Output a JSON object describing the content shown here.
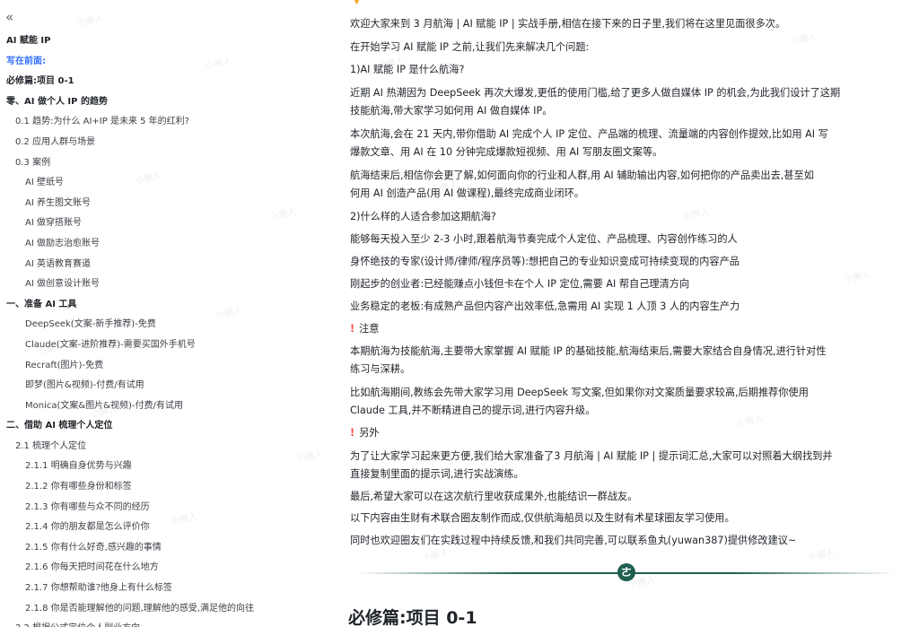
{
  "sidebar": {
    "toc": [
      {
        "label": "AI 赋能 IP",
        "level": 1
      },
      {
        "label": "写在前面:",
        "level": 1,
        "active": true
      },
      {
        "label": "必修篇:项目 0-1",
        "level": 1
      },
      {
        "label": "零、AI 做个人 IP 的趋势",
        "level": 1
      },
      {
        "label": "0.1 趋势:为什么 AI+IP 是未来 5 年的红利?",
        "level": 2
      },
      {
        "label": "0.2 应用人群与场景",
        "level": 2
      },
      {
        "label": "0.3 案例",
        "level": 2
      },
      {
        "label": "AI 壁纸号",
        "level": 3
      },
      {
        "label": "AI 养生图文账号",
        "level": 3
      },
      {
        "label": "AI 做穿搭账号",
        "level": 3
      },
      {
        "label": "AI 做励志治愈账号",
        "level": 3
      },
      {
        "label": "AI 英语教育赛道",
        "level": 3
      },
      {
        "label": "AI 做创意设计账号",
        "level": 3
      },
      {
        "label": "一、准备 AI 工具",
        "level": 1
      },
      {
        "label": "DeepSeek(文案-新手推荐)-免费",
        "level": 3
      },
      {
        "label": "Claude(文案-进阶推荐)-需要买国外手机号",
        "level": 3
      },
      {
        "label": "Recraft(图片)-免费",
        "level": 3
      },
      {
        "label": "即梦(图片&视频)-付费/有试用",
        "level": 3
      },
      {
        "label": "Monica(文案&图片&视频)-付费/有试用",
        "level": 3
      },
      {
        "label": "二、借助 AI 梳理个人定位",
        "level": 1
      },
      {
        "label": "2.1 梳理个人定位",
        "level": 2
      },
      {
        "label": "2.1.1 明确自身优势与兴趣",
        "level": 4
      },
      {
        "label": "2.1.2 你有哪些身份和标签",
        "level": 4
      },
      {
        "label": "2.1.3 你有哪些与众不同的经历",
        "level": 4
      },
      {
        "label": "2.1.4 你的朋友都是怎么评价你",
        "level": 4
      },
      {
        "label": "2.1.5 你有什么好奇,感兴趣的事情",
        "level": 4
      },
      {
        "label": "2.1.6 你每天把时间花在什么地方",
        "level": 4
      },
      {
        "label": "2.1.7 你想帮助谁?他身上有什么标签",
        "level": 4
      },
      {
        "label": "2.1.8 你是否能理解他的问题,理解他的感受,满足他的向往",
        "level": 4
      },
      {
        "label": "2.2 根据公式定位个人副业方向",
        "level": 2
      }
    ]
  },
  "content": {
    "paragraphs": [
      {
        "text": "欢迎大家来到 3 月航海 | AI 赋能 IP | 实战手册,相信在接下来的日子里,我们将在这里见面很多次。"
      },
      {
        "text": "在开始学习 AI 赋能 IP 之前,让我们先来解决几个问题:"
      },
      {
        "text": "1)AI 赋能 IP 是什么航海?"
      },
      {
        "text": "近期 AI 热潮因为 DeepSeek 再次大爆发,更低的使用门槛,给了更多人做自媒体 IP 的机会,为此我们设计了这期"
      },
      {
        "text": "技能航海,带大家学习如何用 AI 做自媒体 IP。"
      },
      {
        "text": "本次航海,会在 21 天内,带你借助 AI 完成个人 IP 定位、产品端的梳理、流量端的内容创作提效,比如用 AI 写"
      },
      {
        "text": "爆款文章、用 AI 在 10 分钟完成爆款短视频、用 AI 写朋友圈文案等。"
      },
      {
        "text": "航海结束后,相信你会更了解,如何面向你的行业和人群,用 AI 辅助输出内容,如何把你的产品卖出去,甚至如"
      },
      {
        "text": "何用 AI 创造产品(用 AI 做课程),最终完成商业闭环。"
      },
      {
        "text": "2)什么样的人适合参加这期航海?"
      },
      {
        "text": "能够每天投入至少 2-3 小时,跟着航海节奏完成个人定位、产品梳理、内容创作练习的人"
      },
      {
        "text": "身怀绝技的专家(设计师/律师/程序员等):想把自己的专业知识变成可持续变现的内容产品"
      },
      {
        "text": "刚起步的创业者:已经能赚点小钱但卡在个人 IP 定位,需要 AI 帮自己理清方向"
      },
      {
        "text": "业务稳定的老板:有成熟产品但内容产出效率低,急需用 AI 实现 1 人顶 3 人的内容生产力"
      },
      {
        "text": "注意",
        "warn": "!"
      },
      {
        "text": "本期航海为技能航海,主要带大家掌握 AI 赋能 IP 的基础技能,航海结束后,需要大家结合自身情况,进行针对性"
      },
      {
        "text": "练习与深耕。"
      },
      {
        "text": "比如航海期间,教练会先带大家学习用 DeepSeek 写文案,但如果你对文案质量要求较高,后期推荐你使用"
      },
      {
        "text": "Claude 工具,并不断精进自己的提示词,进行内容升级。"
      },
      {
        "text": "另外",
        "warn": "!"
      },
      {
        "text": "为了让大家学习起来更方便,我们给大家准备了3 月航海 | AI 赋能 IP | 提示词汇总,大家可以对照着大纲找到并"
      },
      {
        "text": "直接复制里面的提示词,进行实战演练。"
      },
      {
        "text": "最后,希望大家可以在这次航行里收获成果外,也能结识一群战友。"
      },
      {
        "text": "以下内容由生财有术联合圈友制作而成,仅供航海船员以及生财有术星球圈友学习使用。"
      },
      {
        "text": "同时也欢迎圈友们在实践过程中持续反馈,和我们共同完善,可以联系鱼丸(yuwan387)提供修改建议~"
      }
    ],
    "divider_glyph": "ㄜ",
    "section_title": "必修篇:项目 0-1"
  },
  "watermark_text": "小懒人",
  "colors": {
    "accent": "#3370ff",
    "divider": "#1f5f50",
    "warn": "#f54a45"
  }
}
